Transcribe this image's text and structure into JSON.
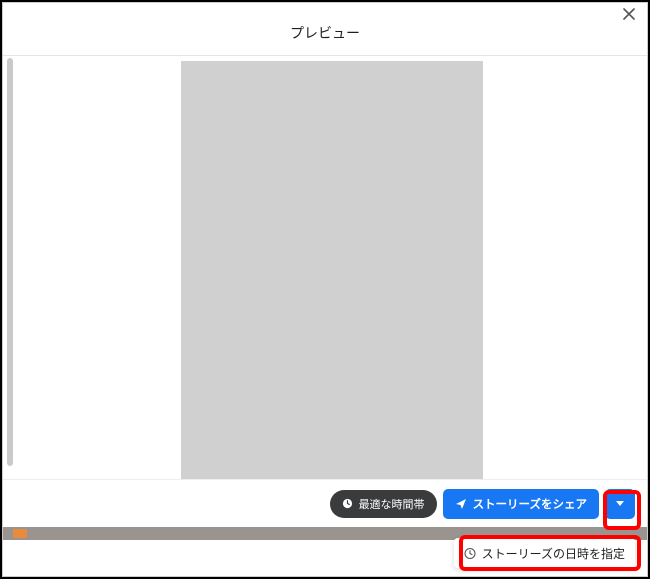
{
  "header": {
    "title": "プレビュー"
  },
  "footer": {
    "best_time_label": "最適な時間帯",
    "share_button_label": "ストーリーズをシェア"
  },
  "dropdown": {
    "schedule_label": "ストーリーズの日時を指定"
  }
}
